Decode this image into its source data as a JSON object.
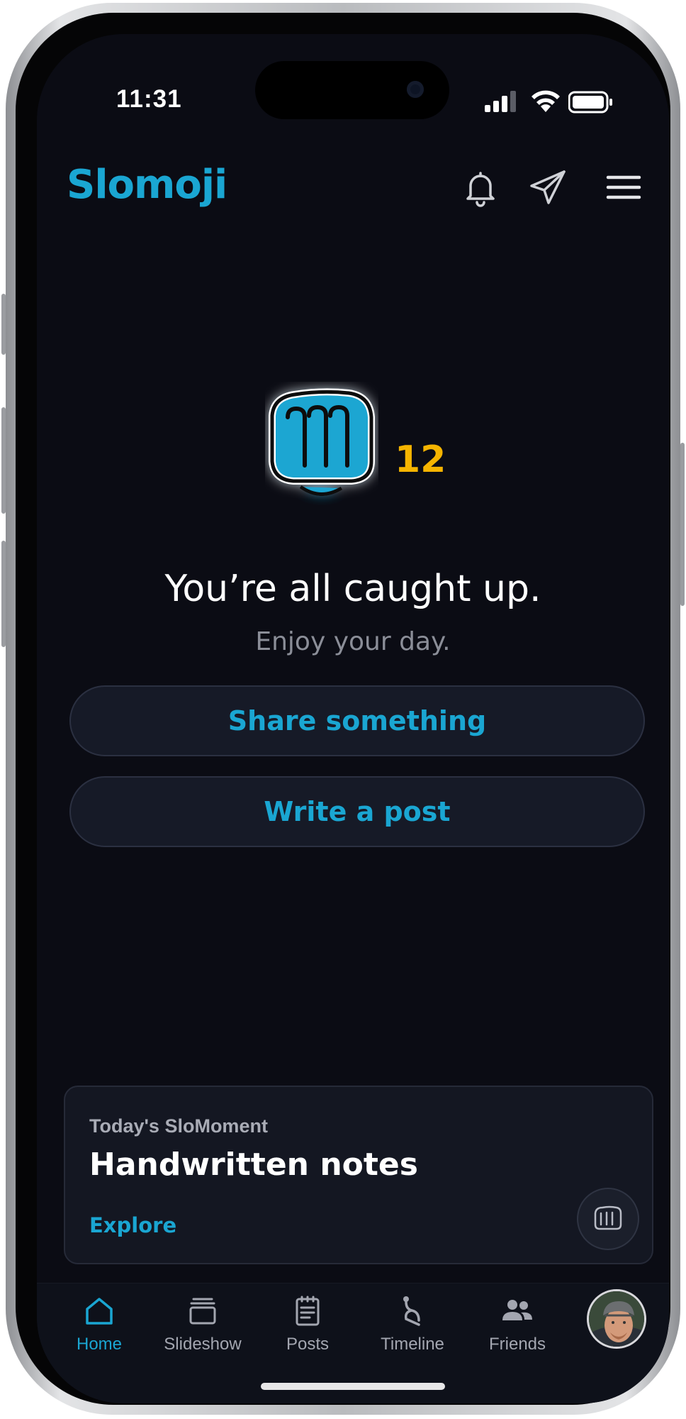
{
  "status_bar": {
    "time": "11:31"
  },
  "header": {
    "logo": "Slomoji",
    "icons": [
      "bell-icon",
      "paper-plane-icon",
      "hamburger-menu-icon"
    ]
  },
  "hero": {
    "fist_count": "12",
    "title": "You’re all caught up.",
    "subtitle": "Enjoy your day."
  },
  "actions": {
    "share_label": "Share something",
    "write_label": "Write a post"
  },
  "moment_card": {
    "kicker": "Today's SloMoment",
    "title": "Handwritten notes",
    "link": "Explore",
    "icon": "fist-icon"
  },
  "tabbar": {
    "tabs": [
      {
        "label": "Home",
        "icon": "home-icon",
        "active": true
      },
      {
        "label": "Slideshow",
        "icon": "slideshow-icon",
        "active": false
      },
      {
        "label": "Posts",
        "icon": "posts-icon",
        "active": false
      },
      {
        "label": "Timeline",
        "icon": "timeline-icon",
        "active": false
      },
      {
        "label": "Friends",
        "icon": "friends-icon",
        "active": false
      }
    ],
    "profile_icon": "profile-avatar"
  },
  "colors": {
    "accent": "#1aa6d2",
    "count": "#f5b400",
    "background": "#0b0c14",
    "card": "#141722"
  }
}
